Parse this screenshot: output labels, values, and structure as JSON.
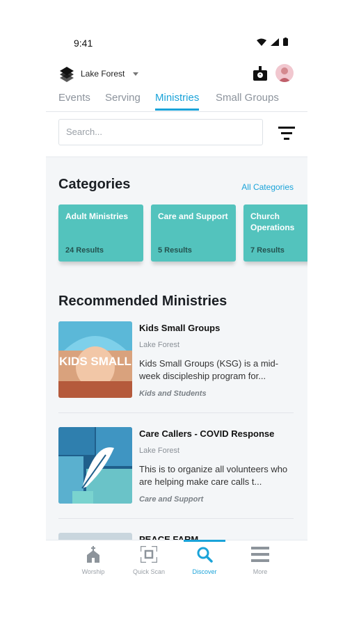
{
  "status_bar": {
    "time": "9:41"
  },
  "header": {
    "location": "Lake Forest"
  },
  "tabs": [
    {
      "label": "Events"
    },
    {
      "label": "Serving"
    },
    {
      "label": "Ministries"
    },
    {
      "label": "Small Groups"
    }
  ],
  "search": {
    "placeholder": "Search..."
  },
  "categories": {
    "title": "Categories",
    "all_link": "All Categories",
    "items": [
      {
        "name": "Adult Ministries",
        "count": "24 Results"
      },
      {
        "name": "Care and Support",
        "count": "5 Results"
      },
      {
        "name": "Church Operations",
        "count": "7 Results"
      }
    ]
  },
  "recommended": {
    "title": "Recommended Ministries",
    "items": [
      {
        "title": "Kids Small Groups",
        "location": "Lake Forest",
        "description": "Kids Small Groups (KSG) is a mid-week discipleship program for...",
        "category": "Kids and Students",
        "thumb_text": "KIDS SMALL"
      },
      {
        "title": "Care Callers - COVID Response",
        "location": "Lake Forest",
        "description": "This is to organize all volunteers who are helping make care calls t...",
        "category": "Care and Support"
      },
      {
        "title": "PEACE FARM"
      }
    ]
  },
  "bottom_nav": [
    {
      "label": "Worship",
      "icon": "church-icon"
    },
    {
      "label": "Quick Scan",
      "icon": "scan-icon"
    },
    {
      "label": "Discover",
      "icon": "search-icon",
      "active": true
    },
    {
      "label": "More",
      "icon": "menu-icon"
    }
  ],
  "colors": {
    "accent": "#1aa3d9",
    "category_tile": "#53c3bd"
  }
}
